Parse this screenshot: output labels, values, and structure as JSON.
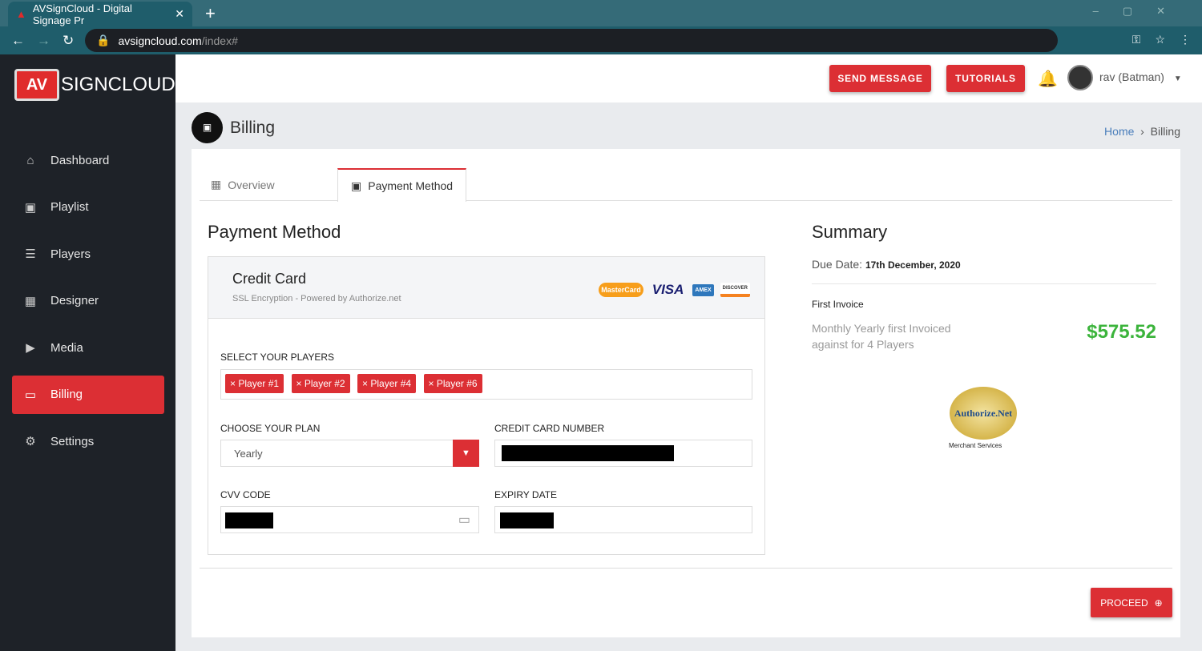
{
  "browser": {
    "tab_title": "AVSignCloud - Digital Signage Pr",
    "url_host": "avsigncloud.com",
    "url_path": "/index#"
  },
  "brand": {
    "logo_text": "SIGNCLOUD",
    "logo_mark": "AV"
  },
  "sidebar": {
    "items": [
      {
        "label": "Dashboard",
        "icon": "home-icon"
      },
      {
        "label": "Playlist",
        "icon": "playlist-icon"
      },
      {
        "label": "Players",
        "icon": "players-icon"
      },
      {
        "label": "Designer",
        "icon": "designer-icon"
      },
      {
        "label": "Media",
        "icon": "media-icon"
      },
      {
        "label": "Billing",
        "icon": "billing-icon",
        "active": true
      },
      {
        "label": "Settings",
        "icon": "gear-icon"
      }
    ]
  },
  "header": {
    "send_message": "SEND MESSAGE",
    "tutorials": "TUTORIALS",
    "user": "rav (Batman)"
  },
  "page": {
    "title": "Billing",
    "breadcrumb": {
      "home": "Home",
      "current": "Billing"
    }
  },
  "tabs": [
    {
      "label": "Overview"
    },
    {
      "label": "Payment Method"
    }
  ],
  "payment": {
    "heading": "Payment Method",
    "card_title": "Credit Card",
    "card_sub": "SSL Encryption - Powered by Authorize.net",
    "card_brands": [
      "MasterCard",
      "VISA",
      "AMEX",
      "DISCOVER"
    ],
    "players_label": "SELECT YOUR PLAYERS",
    "players": [
      "Player #1",
      "Player #2",
      "Player #4",
      "Player #6"
    ],
    "plan_label": "CHOOSE YOUR PLAN",
    "plan_value": "Yearly",
    "cc_label": "CREDIT CARD NUMBER",
    "cvv_label": "CVV CODE",
    "expiry_label": "EXPIRY DATE"
  },
  "summary": {
    "heading": "Summary",
    "due_label": "Due Date:",
    "due_date": "17th December, 2020",
    "invoice_title": "First Invoice",
    "invoice_desc_1": "Monthly Yearly first Invoiced",
    "invoice_desc_2": "against for 4 Players",
    "amount": "$575.52",
    "seal_text": "Authorize.Net",
    "seal_caption": "Merchant Services"
  },
  "proceed": "PROCEED",
  "colors": {
    "accent": "#dc2f34",
    "amount": "#3cb43c",
    "sidebar": "#1e2228"
  }
}
